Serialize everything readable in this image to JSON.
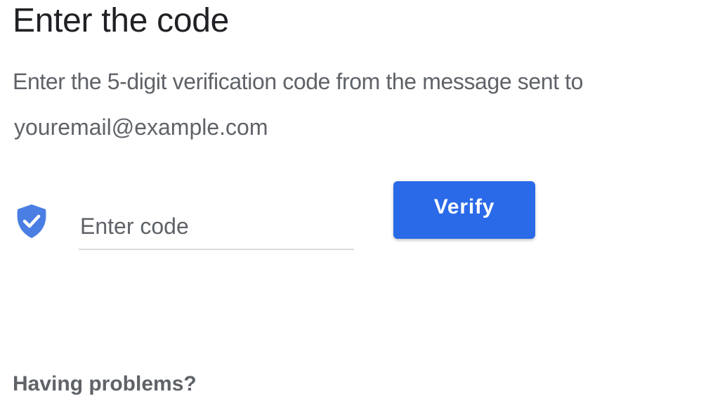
{
  "page": {
    "title": "Enter the code",
    "subtitle": "Enter the 5-digit verification code from the message sent to",
    "email": "youremail@example.com"
  },
  "code_field": {
    "placeholder": "Enter code",
    "icon": "shield-check-icon"
  },
  "verify_button": {
    "label": "Verify"
  },
  "help": {
    "label": "Having problems?"
  },
  "colors": {
    "accent": "#2a6ae8",
    "shield": "#4a7ee3",
    "text_primary": "#202124",
    "text_secondary": "#5f6368",
    "divider": "#dadce0"
  }
}
